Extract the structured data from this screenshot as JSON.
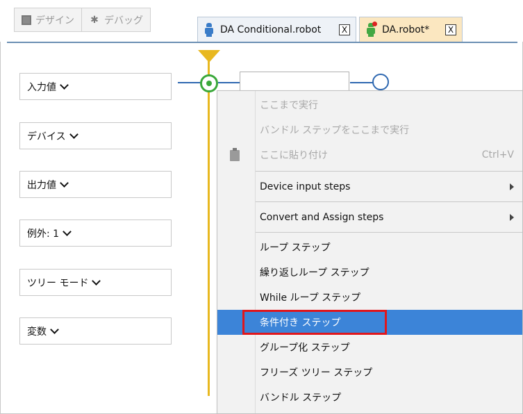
{
  "toolbar": {
    "design_label": "デザイン",
    "debug_label": "デバッグ",
    "design_icon": "design-icon",
    "debug_icon": "debug-bug-icon"
  },
  "tabs": [
    {
      "label": "DA Conditional.robot",
      "icon": "robot-icon-blue",
      "close": "X"
    },
    {
      "label": "DA.robot*",
      "icon": "robot-icon-green-modified",
      "close": "X"
    }
  ],
  "left_panel": {
    "items": [
      {
        "label": "入力値"
      },
      {
        "label": "デバイス"
      },
      {
        "label": "出力値"
      },
      {
        "label": "例外: 1"
      },
      {
        "label": "ツリー モード"
      },
      {
        "label": "変数"
      }
    ]
  },
  "context_menu": {
    "items": [
      {
        "label": "ここまで実行",
        "enabled": false
      },
      {
        "label": "バンドル ステップをここまで実行",
        "enabled": false
      },
      {
        "label": "ここに貼り付け",
        "shortcut": "Ctrl+V",
        "enabled": false
      },
      {
        "label": "Device input steps",
        "submenu": true
      },
      {
        "label": "Convert and Assign steps",
        "submenu": true
      },
      {
        "label": "ループ ステップ"
      },
      {
        "label": "繰り返しループ ステップ"
      },
      {
        "label": "While ループ ステップ"
      },
      {
        "label": "条件付き ステップ",
        "selected": true
      },
      {
        "label": "グループ化 ステップ"
      },
      {
        "label": "フリーズ ツリー ステップ"
      },
      {
        "label": "バンドル ステップ"
      }
    ]
  },
  "colors": {
    "selection": "#3c84d8",
    "highlight_box": "#e0161c",
    "flow_line": "#2d67b0",
    "timeline": "#e8b820",
    "node": "#3aa83a"
  }
}
